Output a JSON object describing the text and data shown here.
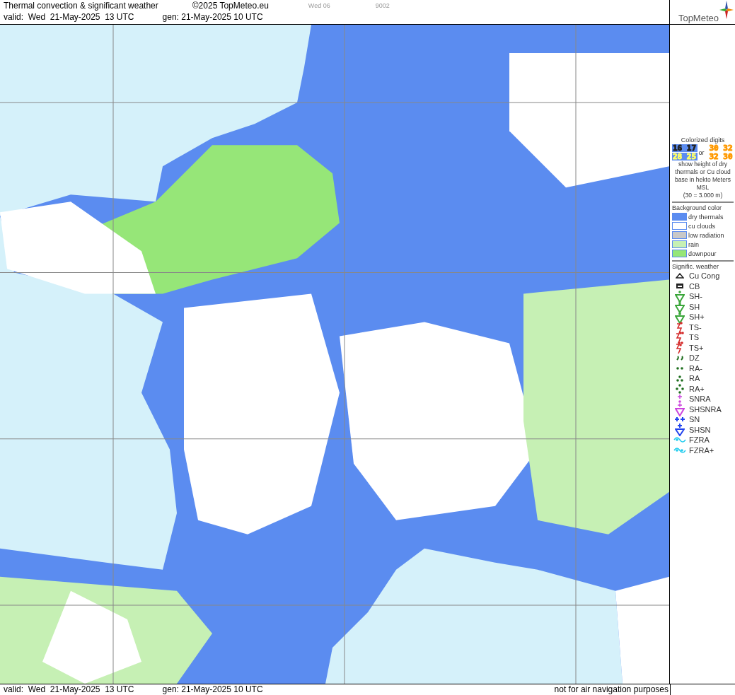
{
  "header": {
    "title": "Thermal convection & significant weather",
    "copyright": "©2025 TopMeteo.eu",
    "day": "Wed 06",
    "code": "9002",
    "valid": "valid:  Wed  21-May-2025  13 UTC",
    "gen": "gen: 21-May-2025 10 UTC",
    "logo": "TopMeteo"
  },
  "legend": {
    "digits_title": "Colorized digits",
    "samples": [
      {
        "text": "16 17",
        "kind": "dry_low"
      },
      {
        "text": "30 32",
        "kind": "cu_high"
      },
      {
        "text": "28 25",
        "kind": "dry_high"
      },
      {
        "text": "32 30",
        "kind": "cu_high"
      }
    ],
    "or": "or",
    "digits_note": "show height of dry thermals or Cu cloud base in hekto Meters MSL",
    "digits_example": "(30 = 3.000 m)",
    "background_title": "Background color",
    "backgrounds": [
      {
        "label": "dry thermals",
        "color": "#5b8cf0"
      },
      {
        "label": "cu clouds",
        "color": "#ffffff"
      },
      {
        "label": "low radiation",
        "color": "#c8c8c8"
      },
      {
        "label": "rain",
        "color": "#c6f0b4"
      },
      {
        "label": "downpour",
        "color": "#96e678"
      }
    ],
    "weather_title": "Signific. weather",
    "weather": [
      {
        "kind": "cucong",
        "label": "Cu Cong",
        "color": "#222222"
      },
      {
        "kind": "cb",
        "label": "CB",
        "color": "#222222"
      },
      {
        "kind": "shower1",
        "label": "SH-",
        "color": "#3aa63a"
      },
      {
        "kind": "shower2",
        "label": "SH",
        "color": "#3aa63a"
      },
      {
        "kind": "shower3",
        "label": "SH+",
        "color": "#3aa63a"
      },
      {
        "kind": "storm1",
        "label": "TS-",
        "color": "#d42a2a"
      },
      {
        "kind": "storm2",
        "label": "TS",
        "color": "#d42a2a"
      },
      {
        "kind": "storm3",
        "label": "TS+",
        "color": "#d42a2a"
      },
      {
        "kind": "drizzle",
        "label": "DZ",
        "color": "#1e6e1e"
      },
      {
        "kind": "rain1",
        "label": "RA-",
        "color": "#1e6e1e"
      },
      {
        "kind": "rain2",
        "label": "RA",
        "color": "#1e6e1e"
      },
      {
        "kind": "rain3",
        "label": "RA+",
        "color": "#1e6e1e"
      },
      {
        "kind": "snra",
        "label": "SNRA",
        "color": "#cc44dd"
      },
      {
        "kind": "shsnra",
        "label": "SHSNRA",
        "color": "#cc44dd"
      },
      {
        "kind": "snow",
        "label": "SN",
        "color": "#2244ee"
      },
      {
        "kind": "shsnow",
        "label": "SHSN",
        "color": "#2244ee"
      },
      {
        "kind": "fzra1",
        "label": "FZRA",
        "color": "#22ccee"
      },
      {
        "kind": "fzra2",
        "label": "FZRA+",
        "color": "#22ccee"
      }
    ]
  },
  "footer": {
    "valid": "valid:  Wed  21-May-2025  13 UTC",
    "gen": "gen: 21-May-2025 10 UTC",
    "note": "not for air navigation purposes"
  }
}
